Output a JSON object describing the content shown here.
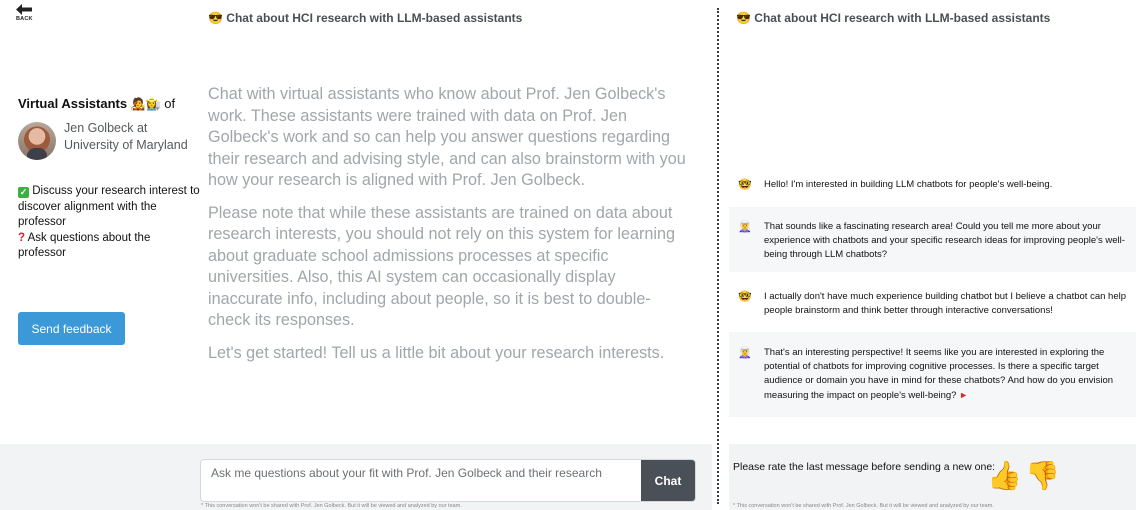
{
  "left": {
    "back_label": "BACK",
    "title": "😎 Chat about HCI research with LLM-based assistants",
    "sidebar": {
      "heading": "Virtual Assistants",
      "heading_emoji": "🧑‍🎤👩‍🌾",
      "heading_suffix": "of",
      "prof_name": "Jen Golbeck at University of Maryland",
      "items": [
        {
          "marker": "✓",
          "text": "Discuss your research interest to discover alignment with the professor"
        },
        {
          "marker": "?",
          "text": "Ask questions about the professor"
        }
      ],
      "feedback_label": "Send feedback"
    },
    "intro": [
      "Chat with virtual assistants who know about Prof. Jen Golbeck's work. These assistants were trained with data on Prof. Jen Golbeck's work and so can help you answer questions regarding their research and advising style, and can also brainstorm with you how your research is aligned with Prof. Jen Golbeck.",
      "Please note that while these assistants are trained on data about research interests, you should not rely on this system for learning about graduate school admissions processes at specific universities. Also, this AI system can occasionally display inaccurate info, including about people, so it is best to double-check its responses.",
      "Let's get started! Tell us a little bit about your research interests."
    ],
    "input_placeholder": "Ask me questions about your fit with Prof. Jen Golbeck and their research",
    "chat_label": "Chat",
    "footnote": "* This conversation won't be shared with Prof. Jen Golbeck. But it will be viewed and analyzed by our team."
  },
  "right": {
    "title": "😎 Chat about HCI research with LLM-based assistants",
    "messages": [
      {
        "role": "user",
        "avatar": "🤓",
        "text": "Hello! I'm interested in building LLM chatbots for people's well-being."
      },
      {
        "role": "bot",
        "avatar": "🧝‍♀️",
        "text": "That sounds like a fascinating research area! Could you tell me more about your experience with chatbots and your specific research ideas for improving people's well-being through LLM chatbots?"
      },
      {
        "role": "user",
        "avatar": "🤓",
        "text": "I actually don't have much experience building chatbot but I believe a chatbot can help people brainstorm and think better through interactive conversations!"
      },
      {
        "role": "bot",
        "avatar": "🧝‍♀️",
        "text": "That's an interesting perspective! It seems like you are interested in exploring the potential of chatbots for improving cognitive processes. Is there a specific target audience or domain you have in mind for these chatbots? And how do you envision measuring the impact on people's well-being?",
        "suffix": "►"
      }
    ],
    "rate_prompt": "Please rate the last message before sending a new one:",
    "thumb_up": "👍",
    "thumb_down": "👎",
    "footnote": "* This conversation won't be shared with Prof. Jen Golbeck. But it will be viewed and analyzed by our team."
  },
  "colors": {
    "feedback_button": "#3c99d8",
    "chat_button": "#495057",
    "intro_text": "#a1a6ab",
    "bot_bubble": "#f5f7f8"
  }
}
